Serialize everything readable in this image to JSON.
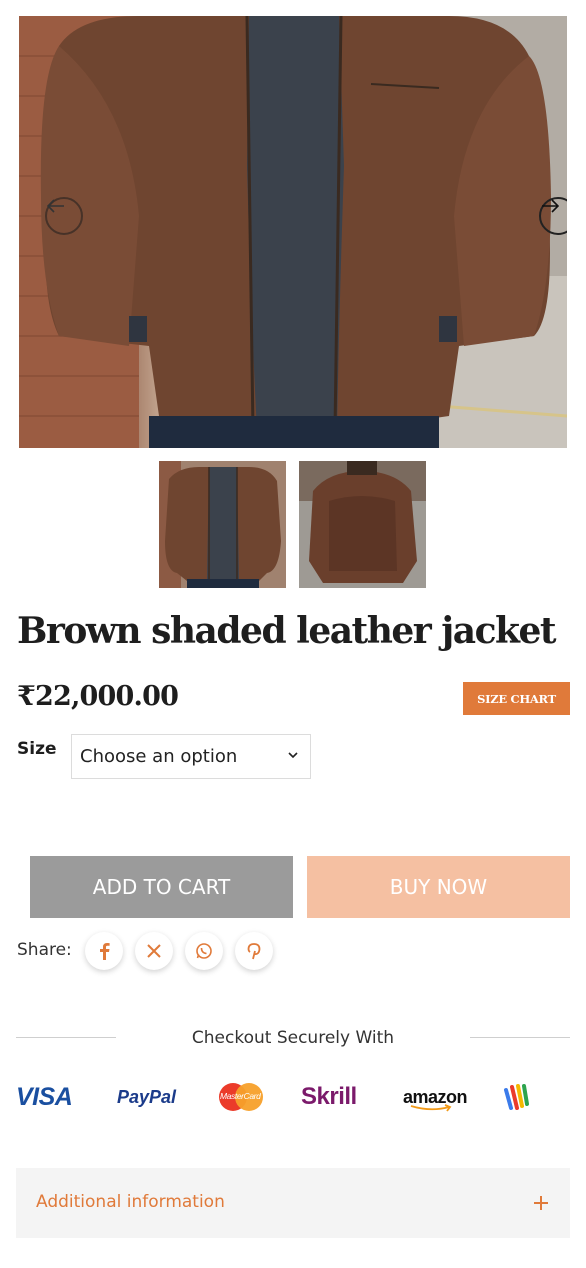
{
  "product": {
    "title": "Brown shaded leather jacket",
    "price": "₹22,000.00",
    "size_chart_label": "SIZE CHART",
    "size_label": "Size",
    "size_select_value": "Choose an option"
  },
  "actions": {
    "add_to_cart": "ADD TO CART",
    "buy_now": "BUY NOW"
  },
  "share": {
    "label": "Share:",
    "icons": [
      "facebook-icon",
      "x-icon",
      "whatsapp-icon",
      "pinterest-icon"
    ]
  },
  "checkout": {
    "title": "Checkout Securely With",
    "logos": {
      "visa": "VISA",
      "paypal": "PayPal",
      "mastercard": "MasterCard",
      "skrill": "Skrill",
      "amazon": "amazon"
    }
  },
  "accordion": {
    "additional_info": "Additional information"
  },
  "colors": {
    "accent": "#e07a3a",
    "cart_button": "#9b9b9b",
    "buy_button": "#f5c0a2"
  }
}
